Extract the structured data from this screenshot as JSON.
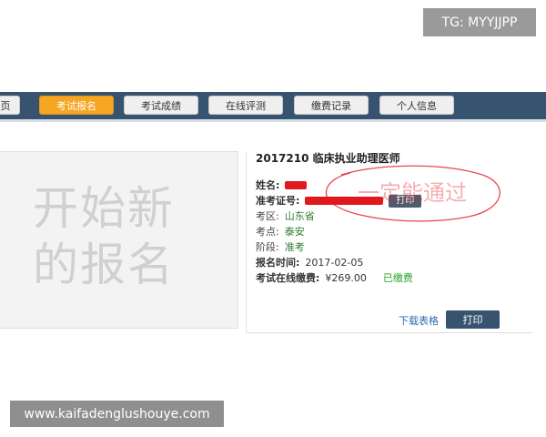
{
  "badge": "TG: MYYJJPP",
  "nav": {
    "tabs": [
      {
        "label": "页",
        "active": false
      },
      {
        "label": "考试报名",
        "active": true
      },
      {
        "label": "考试成绩",
        "active": false
      },
      {
        "label": "在线评测",
        "active": false
      },
      {
        "label": "缴费记录",
        "active": false
      },
      {
        "label": "个人信息",
        "active": false
      }
    ]
  },
  "left_panel": {
    "line1": "开始新",
    "line2": "的报名"
  },
  "info": {
    "title": "2017210 临床执业助理医师",
    "name_label": "姓名:",
    "id_label": "准考证号:",
    "print_inline": "打印",
    "region_label": "考区:",
    "region_value": "山东省",
    "site_label": "考点:",
    "site_value": "泰安",
    "stage_label": "阶段:",
    "stage_value": "准考",
    "time_label": "报名时间:",
    "time_value": "2017-02-05",
    "fee_label": "考试在线缴费:",
    "fee_value": "¥269.00",
    "fee_status": "已缴费"
  },
  "actions": {
    "download": "下载表格",
    "print": "打印"
  },
  "annotation_text": "一定能通过",
  "watermark": "www.kaifadenglushouye.com",
  "colors": {
    "nav_bg": "#37536f",
    "active_tab": "#f5a623",
    "redaction": "#e1191f",
    "paid_green": "#27a427"
  }
}
